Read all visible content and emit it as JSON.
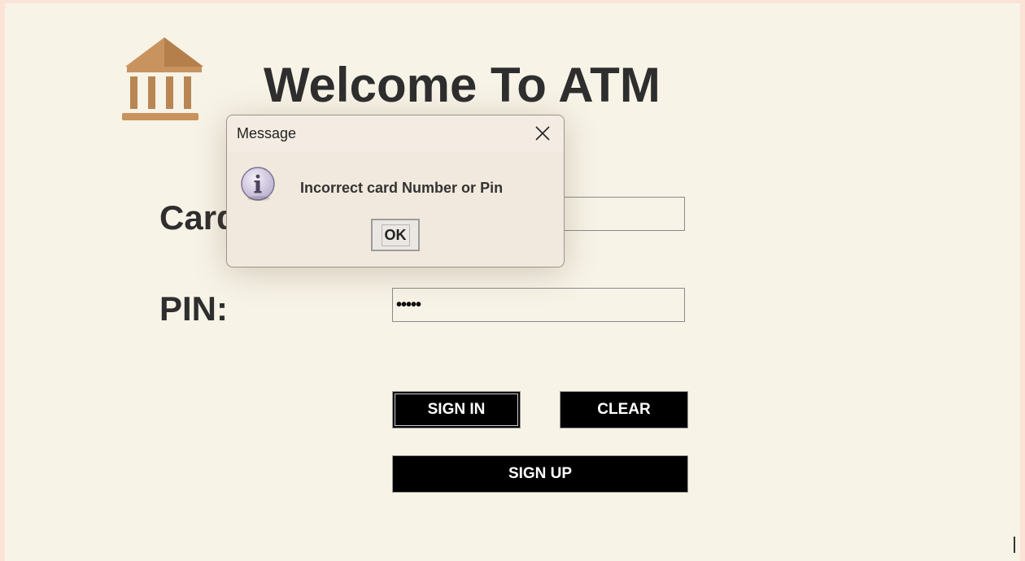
{
  "app": {
    "title": "Welcome To ATM"
  },
  "login": {
    "card_label": "Card No:",
    "pin_label": "PIN:",
    "card_value": "",
    "pin_value": "•••••"
  },
  "buttons": {
    "signin": "SIGN IN",
    "clear": "CLEAR",
    "signup": "SIGN UP"
  },
  "dialog": {
    "title": "Message",
    "message": "Incorrect card Number or Pin",
    "ok": "OK"
  },
  "icons": {
    "logo": "bank-icon",
    "info": "info-icon",
    "close": "close-icon"
  },
  "colors": {
    "background": "#f7f3e7",
    "text": "#2e2e2e",
    "button": "#000000",
    "logo": "#c18a55"
  }
}
